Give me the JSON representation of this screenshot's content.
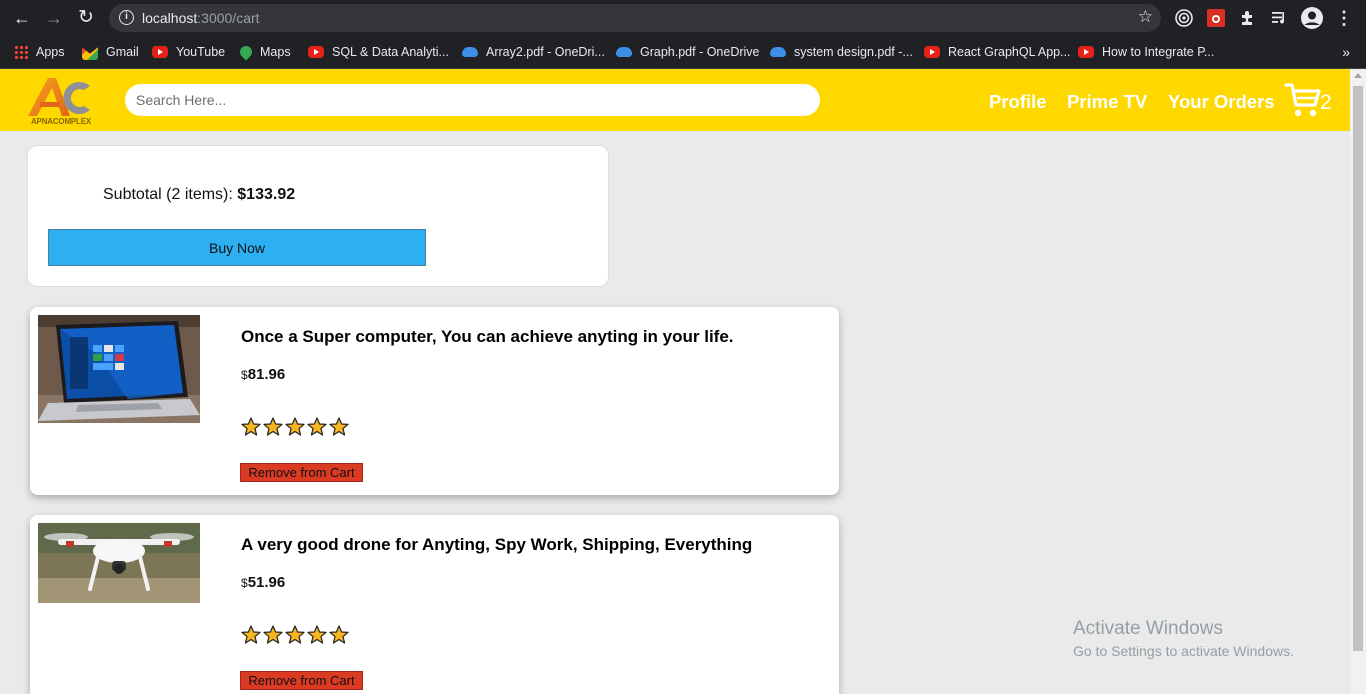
{
  "browser": {
    "url_host": "localhost",
    "url_path": ":3000/cart",
    "bookmarks": [
      {
        "label": "Apps",
        "icon": "apps-icon"
      },
      {
        "label": "Gmail",
        "icon": "gmail-icon"
      },
      {
        "label": "YouTube",
        "icon": "youtube-icon"
      },
      {
        "label": "Maps",
        "icon": "maps-icon"
      },
      {
        "label": "SQL & Data Analyti...",
        "icon": "youtube-icon"
      },
      {
        "label": "Array2.pdf - OneDri...",
        "icon": "onedrive-icon"
      },
      {
        "label": "Graph.pdf - OneDrive",
        "icon": "onedrive-icon"
      },
      {
        "label": "system design.pdf -...",
        "icon": "onedrive-icon"
      },
      {
        "label": "React GraphQL App...",
        "icon": "youtube-icon"
      },
      {
        "label": "How to Integrate P...",
        "icon": "youtube-icon"
      }
    ],
    "more": "»"
  },
  "header": {
    "logo_text": "APNACOMPLEX",
    "search_placeholder": "Search Here...",
    "nav": [
      "Profile",
      "Prime TV",
      "Your Orders"
    ],
    "cart_count": "2"
  },
  "subtotal": {
    "label": "Subtotal (2 items):",
    "amount": "$133.92",
    "buy_label": "Buy Now"
  },
  "products": [
    {
      "title": "Once a Super computer, You can achieve anyting in your life.",
      "currency": "$",
      "price": "81.96",
      "rating": 5,
      "remove_label": "Remove from Cart",
      "image": "laptop"
    },
    {
      "title": "A very good drone for Anyting, Spy Work, Shipping, Everything",
      "currency": "$",
      "price": "51.96",
      "rating": 5,
      "remove_label": "Remove from Cart",
      "image": "drone"
    }
  ],
  "watermark": {
    "line1": "Activate Windows",
    "line2": "Go to Settings to activate Windows."
  },
  "colors": {
    "header": "#ffd800",
    "buy_button": "#2db0f2",
    "remove_button": "#db3a23",
    "page_bg": "#e8eaeb"
  }
}
